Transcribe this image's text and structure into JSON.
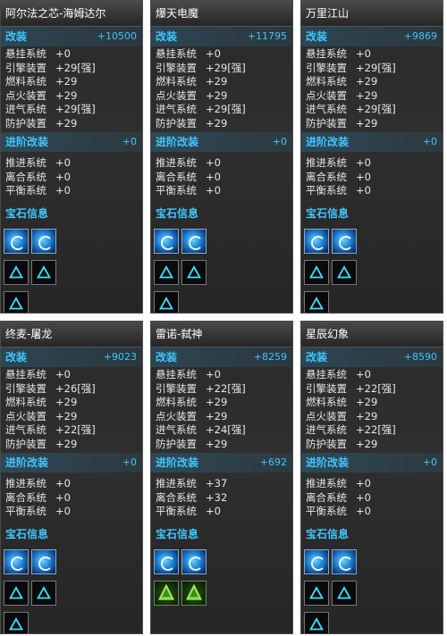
{
  "section_labels": {
    "mod": "改装",
    "adv": "进阶改装",
    "gem": "宝石信息"
  },
  "panels": [
    {
      "name": "阿尔法之芯-海姆达尔",
      "mod_total": "+10500",
      "mods": [
        {
          "label": "悬挂系统",
          "value": "+0"
        },
        {
          "label": "引擎装置",
          "value": "+29[强]"
        },
        {
          "label": "燃料系统",
          "value": "+29"
        },
        {
          "label": "点火装置",
          "value": "+29"
        },
        {
          "label": "进气系统",
          "value": "+29[强]"
        },
        {
          "label": "防护装置",
          "value": "+29"
        }
      ],
      "adv_total": "+0",
      "adv": [
        {
          "label": "推进系统",
          "value": "+0"
        },
        {
          "label": "离合系统",
          "value": "+0"
        },
        {
          "label": "平衡系统",
          "value": "+0"
        }
      ],
      "gems": [
        "blue-swirl-gem-icon",
        "blue-swirl-gem-icon",
        "triangle-empty-slot-icon",
        "triangle-empty-slot-icon",
        "triangle-empty-slot-icon"
      ]
    },
    {
      "name": "爆天电魔",
      "mod_total": "+11795",
      "mods": [
        {
          "label": "悬挂系统",
          "value": "+0"
        },
        {
          "label": "引擎装置",
          "value": "+29[强]"
        },
        {
          "label": "燃料系统",
          "value": "+29"
        },
        {
          "label": "点火装置",
          "value": "+29"
        },
        {
          "label": "进气系统",
          "value": "+29[强]"
        },
        {
          "label": "防护装置",
          "value": "+29"
        }
      ],
      "adv_total": "+0",
      "adv": [
        {
          "label": "推进系统",
          "value": "+0"
        },
        {
          "label": "离合系统",
          "value": "+0"
        },
        {
          "label": "平衡系统",
          "value": "+0"
        }
      ],
      "gems": [
        "blue-swirl-gem-icon",
        "blue-swirl-gem-icon",
        "triangle-empty-slot-icon",
        "triangle-empty-slot-icon",
        "triangle-empty-slot-icon"
      ]
    },
    {
      "name": "万里江山",
      "mod_total": "+9869",
      "mods": [
        {
          "label": "悬挂系统",
          "value": "+0"
        },
        {
          "label": "引擎装置",
          "value": "+29[强]"
        },
        {
          "label": "燃料系统",
          "value": "+29"
        },
        {
          "label": "点火装置",
          "value": "+29"
        },
        {
          "label": "进气系统",
          "value": "+29[强]"
        },
        {
          "label": "防护装置",
          "value": "+29"
        }
      ],
      "adv_total": "+0",
      "adv": [
        {
          "label": "推进系统",
          "value": "+0"
        },
        {
          "label": "离合系统",
          "value": "+0"
        },
        {
          "label": "平衡系统",
          "value": "+0"
        }
      ],
      "gems": [
        "blue-swirl-gem-icon",
        "blue-swirl-gem-icon",
        "triangle-empty-slot-icon",
        "triangle-empty-slot-icon",
        "triangle-empty-slot-icon"
      ]
    },
    {
      "name": "终麦-屠龙",
      "mod_total": "+9023",
      "mods": [
        {
          "label": "悬挂系统",
          "value": "+0"
        },
        {
          "label": "引擎装置",
          "value": "+26[强]"
        },
        {
          "label": "燃料系统",
          "value": "+29"
        },
        {
          "label": "点火装置",
          "value": "+29"
        },
        {
          "label": "进气系统",
          "value": "+22[强]"
        },
        {
          "label": "防护装置",
          "value": "+29"
        }
      ],
      "adv_total": "+0",
      "adv": [
        {
          "label": "推进系统",
          "value": "+0"
        },
        {
          "label": "离合系统",
          "value": "+0"
        },
        {
          "label": "平衡系统",
          "value": "+0"
        }
      ],
      "gems": [
        "blue-swirl-gem-icon",
        "blue-swirl-gem-icon",
        "triangle-empty-slot-icon",
        "triangle-empty-slot-icon",
        "triangle-empty-slot-icon"
      ]
    },
    {
      "name": "雷诺-弑神",
      "mod_total": "+8259",
      "mods": [
        {
          "label": "悬挂系统",
          "value": "+0"
        },
        {
          "label": "引擎装置",
          "value": "+22[强]"
        },
        {
          "label": "燃料系统",
          "value": "+29"
        },
        {
          "label": "点火装置",
          "value": "+29"
        },
        {
          "label": "进气系统",
          "value": "+24[强]"
        },
        {
          "label": "防护装置",
          "value": "+29"
        }
      ],
      "adv_total": "+692",
      "adv": [
        {
          "label": "推进系统",
          "value": "+37"
        },
        {
          "label": "离合系统",
          "value": "+32"
        },
        {
          "label": "平衡系统",
          "value": "+0"
        }
      ],
      "gems": [
        "blue-swirl-gem-icon",
        "blue-swirl-gem-icon",
        "green-triangle-gem-icon",
        "green-triangle-gem-icon"
      ]
    },
    {
      "name": "星辰幻象",
      "mod_total": "+8590",
      "mods": [
        {
          "label": "悬挂系统",
          "value": "+0"
        },
        {
          "label": "引擎装置",
          "value": "+22[强]"
        },
        {
          "label": "燃料系统",
          "value": "+29"
        },
        {
          "label": "点火装置",
          "value": "+29"
        },
        {
          "label": "进气系统",
          "value": "+22[强]"
        },
        {
          "label": "防护装置",
          "value": "+29"
        }
      ],
      "adv_total": "+0",
      "adv": [
        {
          "label": "推进系统",
          "value": "+0"
        },
        {
          "label": "离合系统",
          "value": "+0"
        },
        {
          "label": "平衡系统",
          "value": "+0"
        }
      ],
      "gems": [
        "blue-swirl-gem-icon",
        "blue-swirl-gem-icon",
        "triangle-empty-slot-icon",
        "triangle-empty-slot-icon",
        "triangle-empty-slot-icon"
      ]
    }
  ]
}
